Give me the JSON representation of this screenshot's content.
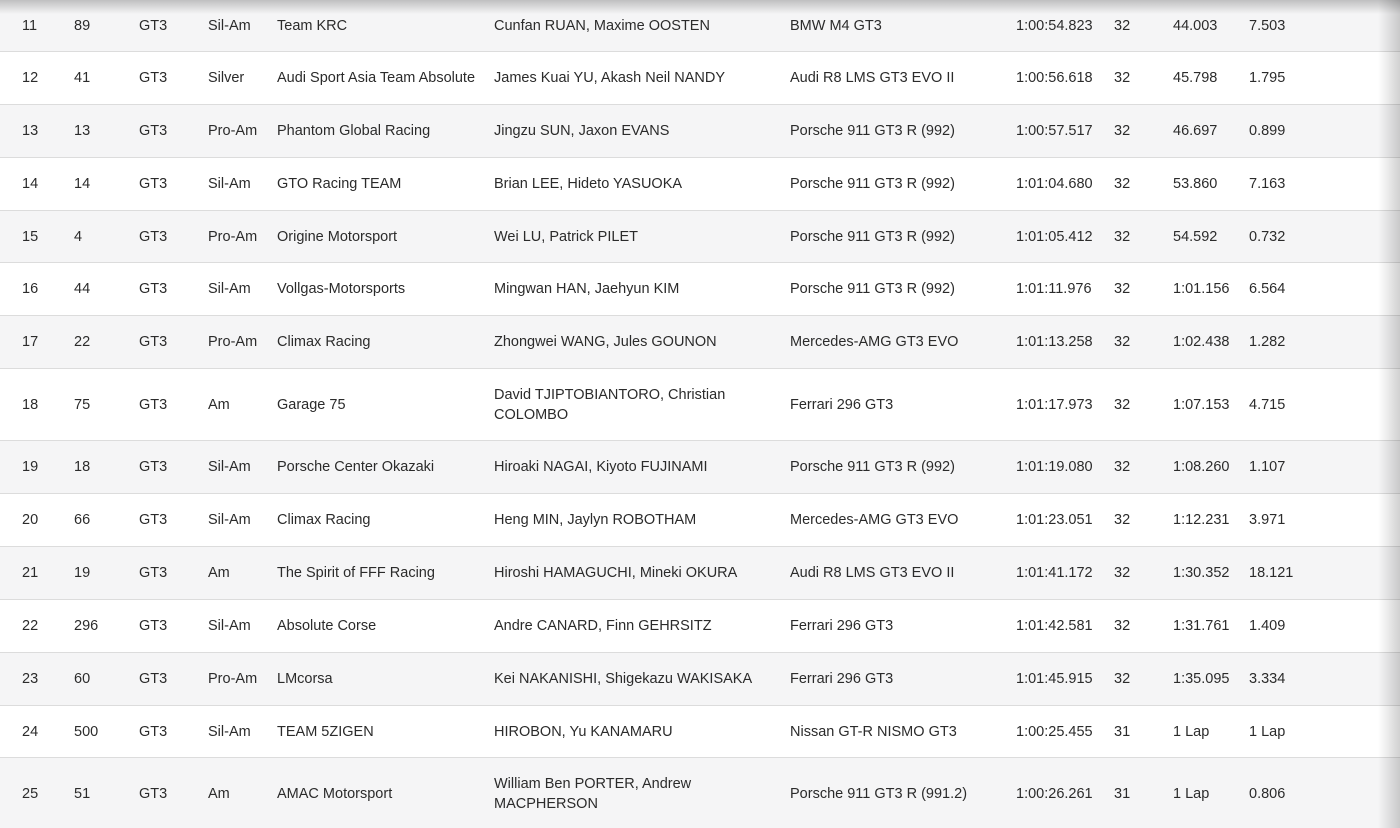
{
  "rows": [
    {
      "pos": "11",
      "num": "89",
      "cls": "GT3",
      "cat": "Sil-Am",
      "team": "Team KRC",
      "drivers": "Cunfan RUAN, Maxime OOSTEN",
      "car": "BMW M4 GT3",
      "time": "1:00:54.823",
      "laps": "32",
      "gap": "44.003",
      "interval": "7.503"
    },
    {
      "pos": "12",
      "num": "41",
      "cls": "GT3",
      "cat": "Silver",
      "team": "Audi Sport Asia Team Absolute",
      "drivers": "James Kuai YU, Akash Neil NANDY",
      "car": "Audi R8 LMS GT3 EVO II",
      "time": "1:00:56.618",
      "laps": "32",
      "gap": "45.798",
      "interval": "1.795"
    },
    {
      "pos": "13",
      "num": "13",
      "cls": "GT3",
      "cat": "Pro-Am",
      "team": "Phantom Global Racing",
      "drivers": "Jingzu SUN, Jaxon EVANS",
      "car": "Porsche 911 GT3 R (992)",
      "time": "1:00:57.517",
      "laps": "32",
      "gap": "46.697",
      "interval": "0.899"
    },
    {
      "pos": "14",
      "num": "14",
      "cls": "GT3",
      "cat": "Sil-Am",
      "team": "GTO Racing TEAM",
      "drivers": "Brian LEE, Hideto YASUOKA",
      "car": "Porsche 911 GT3 R (992)",
      "time": "1:01:04.680",
      "laps": "32",
      "gap": "53.860",
      "interval": "7.163"
    },
    {
      "pos": "15",
      "num": "4",
      "cls": "GT3",
      "cat": "Pro-Am",
      "team": "Origine Motorsport",
      "drivers": "Wei LU, Patrick PILET",
      "car": "Porsche 911 GT3 R (992)",
      "time": "1:01:05.412",
      "laps": "32",
      "gap": "54.592",
      "interval": "0.732"
    },
    {
      "pos": "16",
      "num": "44",
      "cls": "GT3",
      "cat": "Sil-Am",
      "team": "Vollgas-Motorsports",
      "drivers": "Mingwan HAN, Jaehyun KIM",
      "car": "Porsche 911 GT3 R (992)",
      "time": "1:01:11.976",
      "laps": "32",
      "gap": "1:01.156",
      "interval": "6.564"
    },
    {
      "pos": "17",
      "num": "22",
      "cls": "GT3",
      "cat": "Pro-Am",
      "team": "Climax Racing",
      "drivers": "Zhongwei WANG, Jules GOUNON",
      "car": "Mercedes-AMG GT3 EVO",
      "time": "1:01:13.258",
      "laps": "32",
      "gap": "1:02.438",
      "interval": "1.282"
    },
    {
      "pos": "18",
      "num": "75",
      "cls": "GT3",
      "cat": "Am",
      "team": "Garage 75",
      "drivers": "David TJIPTOBIANTORO, Christian COLOMBO",
      "car": "Ferrari 296 GT3",
      "time": "1:01:17.973",
      "laps": "32",
      "gap": "1:07.153",
      "interval": "4.715"
    },
    {
      "pos": "19",
      "num": "18",
      "cls": "GT3",
      "cat": "Sil-Am",
      "team": "Porsche Center Okazaki",
      "drivers": "Hiroaki NAGAI, Kiyoto FUJINAMI",
      "car": "Porsche 911 GT3 R (992)",
      "time": "1:01:19.080",
      "laps": "32",
      "gap": "1:08.260",
      "interval": "1.107"
    },
    {
      "pos": "20",
      "num": "66",
      "cls": "GT3",
      "cat": "Sil-Am",
      "team": "Climax Racing",
      "drivers": "Heng MIN, Jaylyn ROBOTHAM",
      "car": "Mercedes-AMG GT3 EVO",
      "time": "1:01:23.051",
      "laps": "32",
      "gap": "1:12.231",
      "interval": "3.971"
    },
    {
      "pos": "21",
      "num": "19",
      "cls": "GT3",
      "cat": "Am",
      "team": "The Spirit of FFF Racing",
      "drivers": "Hiroshi HAMAGUCHI, Mineki OKURA",
      "car": "Audi R8 LMS GT3 EVO II",
      "time": "1:01:41.172",
      "laps": "32",
      "gap": "1:30.352",
      "interval": "18.121"
    },
    {
      "pos": "22",
      "num": "296",
      "cls": "GT3",
      "cat": "Sil-Am",
      "team": "Absolute Corse",
      "drivers": "Andre CANARD, Finn GEHRSITZ",
      "car": "Ferrari 296 GT3",
      "time": "1:01:42.581",
      "laps": "32",
      "gap": "1:31.761",
      "interval": "1.409"
    },
    {
      "pos": "23",
      "num": "60",
      "cls": "GT3",
      "cat": "Pro-Am",
      "team": "LMcorsa",
      "drivers": "Kei NAKANISHI, Shigekazu WAKISAKA",
      "car": "Ferrari 296 GT3",
      "time": "1:01:45.915",
      "laps": "32",
      "gap": "1:35.095",
      "interval": "3.334"
    },
    {
      "pos": "24",
      "num": "500",
      "cls": "GT3",
      "cat": "Sil-Am",
      "team": "TEAM 5ZIGEN",
      "drivers": "HIROBON, Yu KANAMARU",
      "car": "Nissan GT-R NISMO GT3",
      "time": "1:00:25.455",
      "laps": "31",
      "gap": "1 Lap",
      "interval": "1 Lap"
    },
    {
      "pos": "25",
      "num": "51",
      "cls": "GT3",
      "cat": "Am",
      "team": "AMAC Motorsport",
      "drivers": "William Ben PORTER, Andrew MACPHERSON",
      "car": "Porsche 911 GT3 R (991.2)",
      "time": "1:00:26.261",
      "laps": "31",
      "gap": "1 Lap",
      "interval": "0.806"
    }
  ]
}
